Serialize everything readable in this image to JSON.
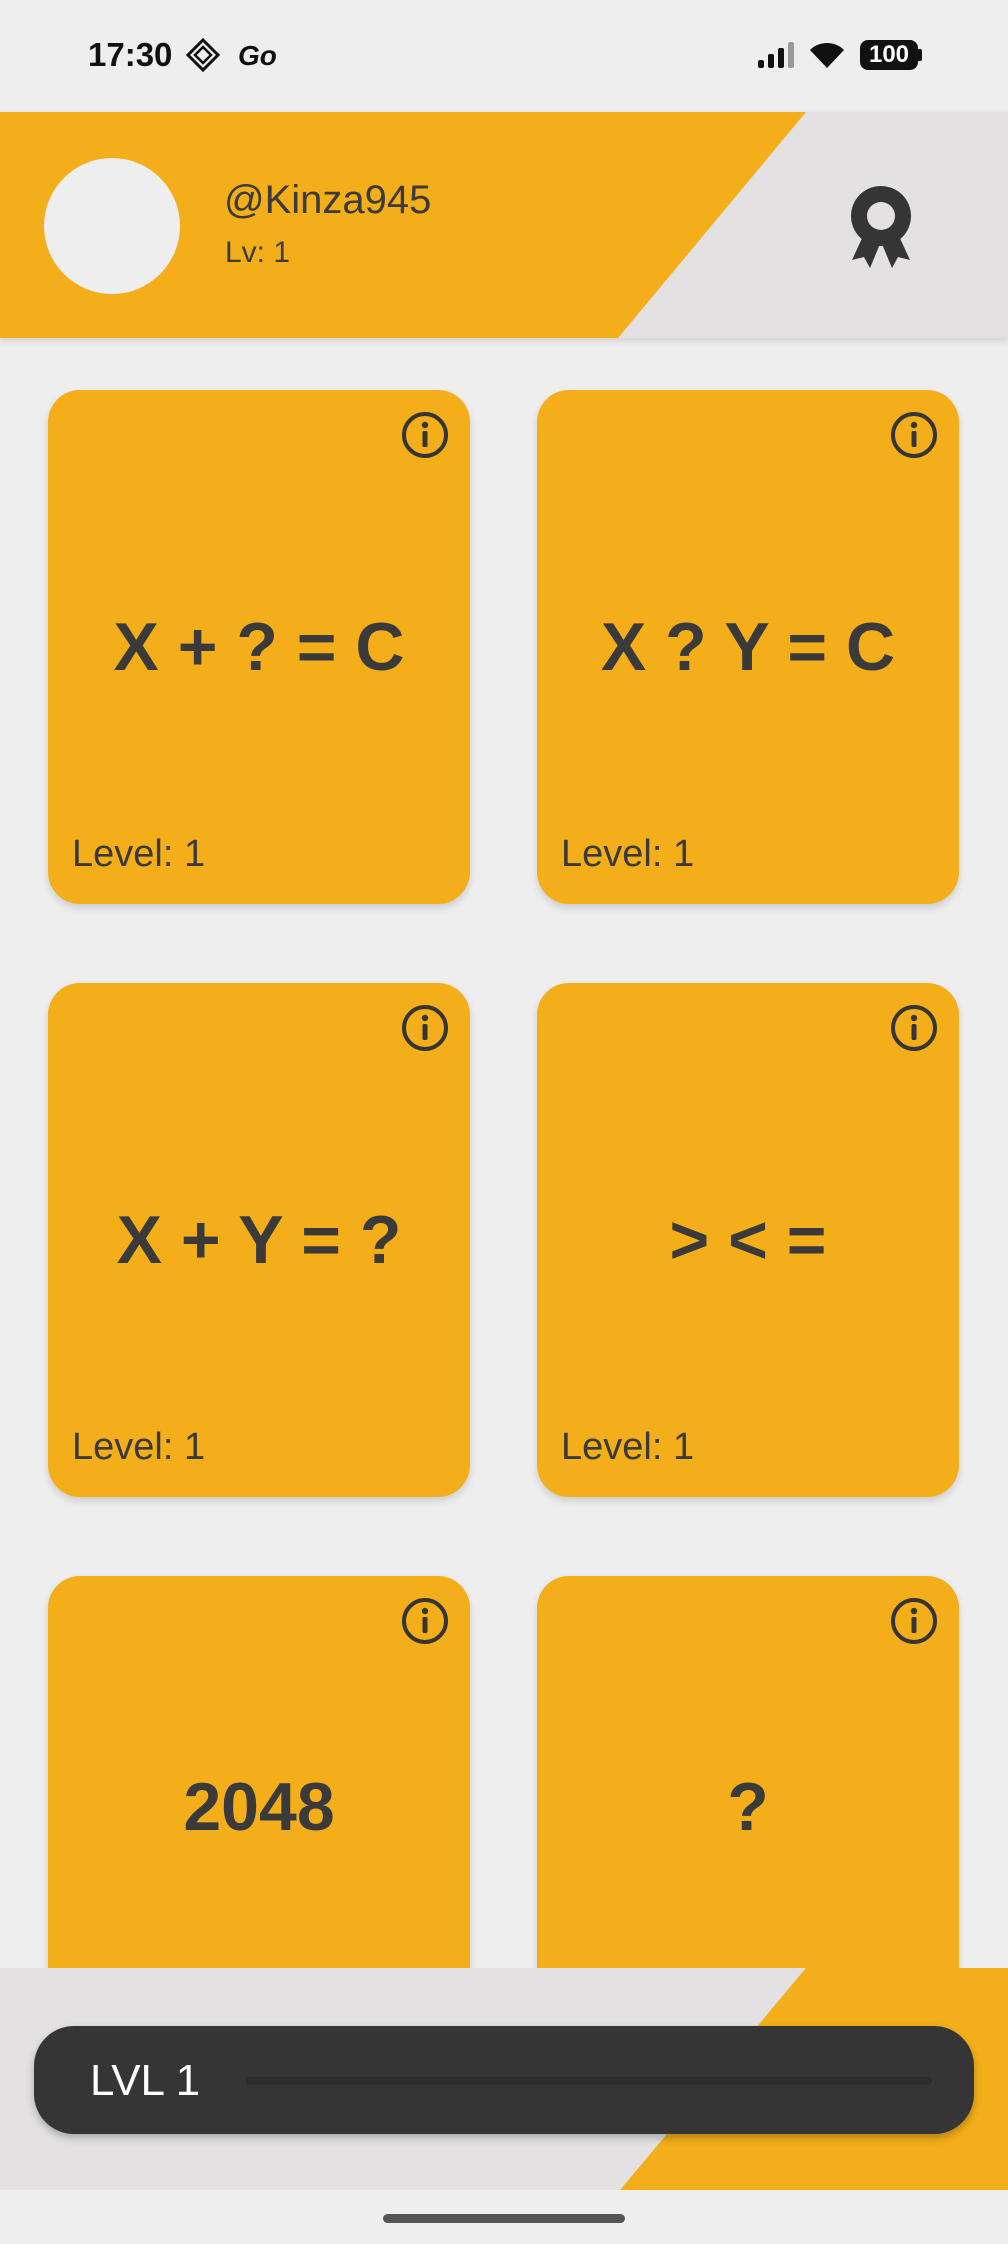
{
  "status_bar": {
    "time": "17:30",
    "battery": "100"
  },
  "header": {
    "username": "@Kinza945",
    "level": "Lv: 1"
  },
  "cards": [
    {
      "expression": "X + ? = C",
      "level_label": "Level: 1"
    },
    {
      "expression": "X ? Y = C",
      "level_label": "Level: 1"
    },
    {
      "expression": "X + Y = ?",
      "level_label": "Level: 1"
    },
    {
      "expression": "> < =",
      "level_label": "Level: 1"
    },
    {
      "expression": "2048",
      "level_label": ""
    },
    {
      "expression": "?",
      "level_label": ""
    }
  ],
  "progress": {
    "label": "LVL 1",
    "fraction": 0.0
  },
  "colors": {
    "accent": "#f3ae19",
    "dark": "#353535",
    "background": "#efeeef",
    "panel": "#e3e1e2"
  }
}
